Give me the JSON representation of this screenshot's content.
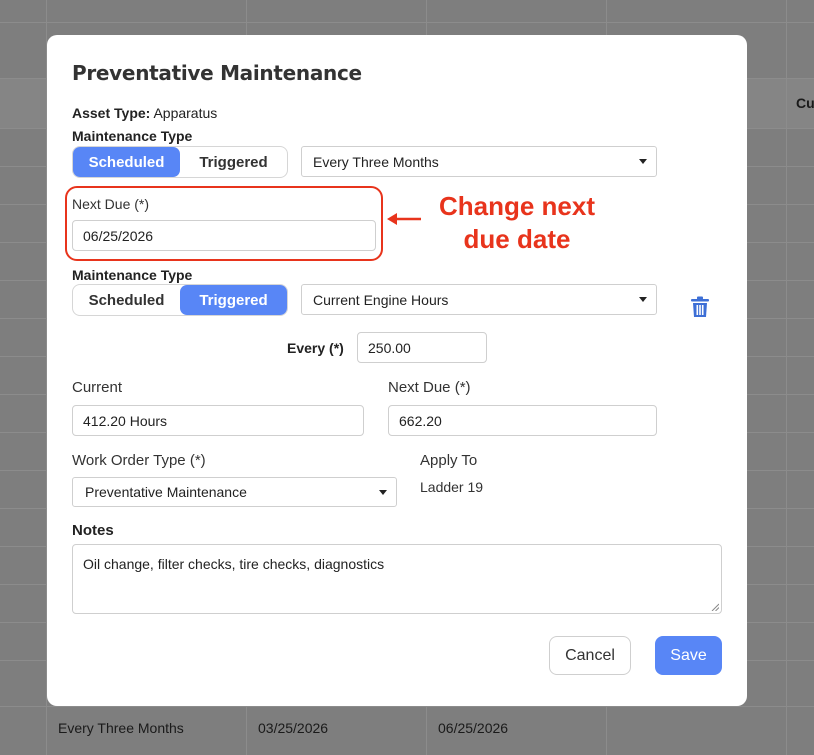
{
  "background": {
    "header_partial": "Cu",
    "row_cells": [
      "Every Three Months",
      "03/25/2026",
      "06/25/2026"
    ]
  },
  "modal": {
    "title": "Preventative Maintenance",
    "asset_type_label": "Asset Type:",
    "asset_type_value": "Apparatus",
    "schedule1": {
      "label": "Maintenance Type",
      "toggle_scheduled": "Scheduled",
      "toggle_triggered": "Triggered",
      "selected": "scheduled",
      "interval": "Every Three Months",
      "next_due_label": "Next Due (*)",
      "next_due_value": "06/25/2026"
    },
    "annotation": "Change next due date",
    "schedule2": {
      "label": "Maintenance Type",
      "toggle_scheduled": "Scheduled",
      "toggle_triggered": "Triggered",
      "selected": "triggered",
      "trigger": "Current Engine Hours",
      "every_label": "Every (*)",
      "every_value": "250.00",
      "current_label": "Current",
      "current_value": "412.20 Hours",
      "next_due_label": "Next Due (*)",
      "next_due_value": "662.20"
    },
    "work_order_label": "Work Order Type (*)",
    "work_order_value": "Preventative Maintenance",
    "apply_to_label": "Apply To",
    "apply_to_value": "Ladder 19",
    "notes_label": "Notes",
    "notes_value": "Oil change, filter checks, tire checks, diagnostics",
    "cancel_label": "Cancel",
    "save_label": "Save"
  },
  "colors": {
    "primary": "#5886f6",
    "annotation": "#e8341c",
    "trash": "#3d6fd6"
  }
}
